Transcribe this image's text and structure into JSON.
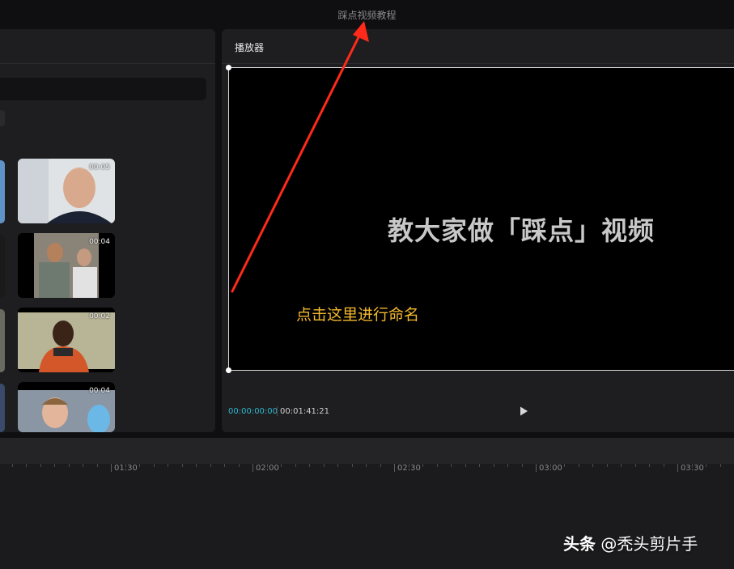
{
  "window": {
    "title": "踩点视频教程"
  },
  "media_panel": {
    "thumbnails": [
      {
        "duration": "00:05"
      },
      {
        "duration": "00:04"
      },
      {
        "duration": "00:02"
      },
      {
        "duration": "00:04"
      }
    ]
  },
  "player": {
    "title": "播放器",
    "caption": "教大家做「踩点」视频",
    "current_time": "00:00:00:00",
    "total_time": "00:01:41:21"
  },
  "annotation": {
    "text": "点击这里进行命名",
    "color": "#f3b82d",
    "arrow_color": "#ff2a1a"
  },
  "timeline": {
    "ruler_labels": [
      "01:30",
      "02:00",
      "02:30",
      "03:00",
      "03:30"
    ]
  },
  "watermark": {
    "brand": "头条",
    "handle": "@秃头剪片手"
  },
  "icons": {
    "play": "play-icon"
  },
  "colors": {
    "timecode_accent": "#2fb8cf",
    "panel_bg": "#1e1e20"
  }
}
